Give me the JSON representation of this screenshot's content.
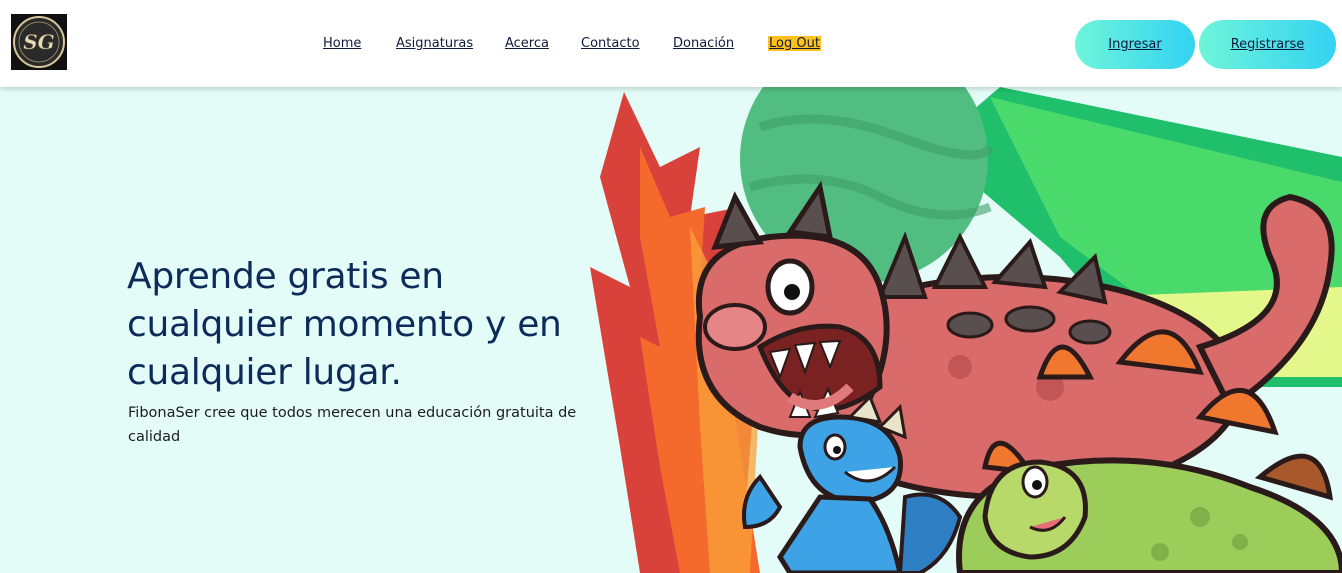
{
  "header": {
    "logo_text": "SG",
    "nav": [
      {
        "label": "Home"
      },
      {
        "label": "Asignaturas"
      },
      {
        "label": "Acerca"
      },
      {
        "label": "Contacto"
      },
      {
        "label": "Donación"
      },
      {
        "label": "Log Out"
      }
    ],
    "login_label": "Ingresar",
    "register_label": "Registrarse"
  },
  "hero": {
    "title": "Aprende gratis en cualquier momento y en cualquier lugar.",
    "subtitle": "FibonaSer cree que todos merecen una educación gratuita de calidad",
    "illustration": "cartoon-dinosaurs-icon"
  },
  "colors": {
    "hero_bg": "#e4fcf7",
    "title": "#0d2b5a",
    "logout_highlight": "#ffc21a",
    "button_gradient_start": "#6ef5da",
    "button_gradient_end": "#33d2f2"
  }
}
